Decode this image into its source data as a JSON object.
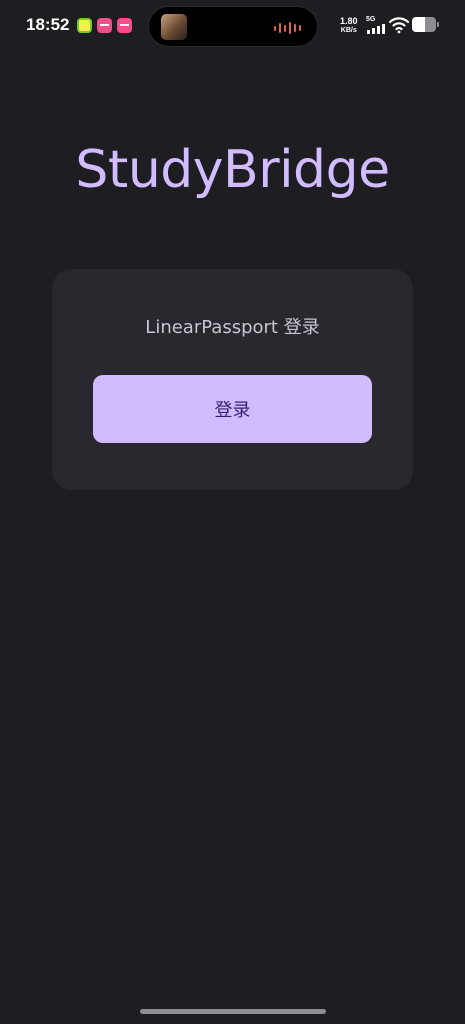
{
  "status_bar": {
    "time": "18:52",
    "net_speed_value": "1.80",
    "net_speed_unit": "KB/s",
    "network_type": "5G",
    "battery_level": 0.55,
    "icons": [
      "app-notification-icon",
      "app-notification-icon",
      "app-notification-icon",
      "signal-icon",
      "wifi-icon",
      "battery-icon"
    ]
  },
  "app": {
    "title": "StudyBridge"
  },
  "login_card": {
    "label": "LinearPassport 登录",
    "button_label": "登录"
  },
  "colors": {
    "background": "#1e1d22",
    "accent": "#d0bcff",
    "card": "#29282e",
    "button_text": "#381e72"
  }
}
